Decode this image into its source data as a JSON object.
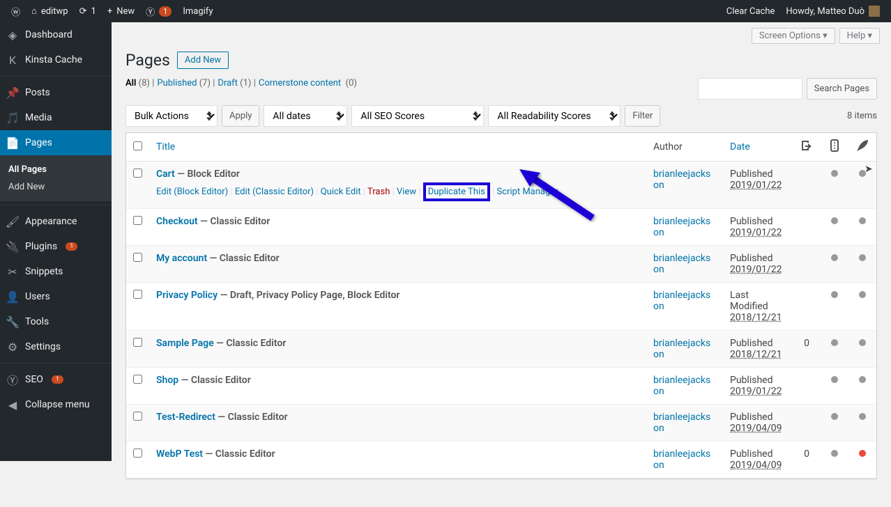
{
  "toolbar": {
    "site_name": "editwp",
    "updates_count": "1",
    "new_label": "New",
    "yoast_label": "",
    "yoast_count": "1",
    "imagify_label": "Imagify",
    "clear_cache": "Clear Cache",
    "howdy": "Howdy, Matteo Duò"
  },
  "sidebar": {
    "items": [
      {
        "icon": "dashboard",
        "label": "Dashboard"
      },
      {
        "icon": "kinsta",
        "label": "Kinsta Cache"
      },
      {
        "icon": "pin",
        "label": "Posts"
      },
      {
        "icon": "media",
        "label": "Media"
      },
      {
        "icon": "page",
        "label": "Pages",
        "current": true
      },
      {
        "icon": "appearance",
        "label": "Appearance"
      },
      {
        "icon": "plugin",
        "label": "Plugins",
        "badge": "1"
      },
      {
        "icon": "snippets",
        "label": "Snippets"
      },
      {
        "icon": "users",
        "label": "Users"
      },
      {
        "icon": "tools",
        "label": "Tools"
      },
      {
        "icon": "settings",
        "label": "Settings"
      },
      {
        "icon": "seo",
        "label": "SEO",
        "badge": "1"
      },
      {
        "icon": "collapse",
        "label": "Collapse menu"
      }
    ],
    "submenu": [
      "All Pages",
      "Add New"
    ]
  },
  "screen": {
    "options": "Screen Options",
    "help": "Help"
  },
  "page": {
    "title": "Pages",
    "add_new": "Add New"
  },
  "filters": {
    "all": "All",
    "all_count": "(8)",
    "published": "Published",
    "published_count": "(7)",
    "draft": "Draft",
    "draft_count": "(1)",
    "cornerstone": "Cornerstone content",
    "cornerstone_count": "(0)"
  },
  "actions": {
    "bulk": "Bulk Actions",
    "apply": "Apply",
    "dates": "All dates",
    "seo": "All SEO Scores",
    "readability": "All Readability Scores",
    "filter": "Filter",
    "item_count": "8 items",
    "search": "Search Pages"
  },
  "table": {
    "headers": {
      "title": "Title",
      "author": "Author",
      "date": "Date",
      "comments": ""
    },
    "row_actions": {
      "edit_block": "Edit (Block Editor)",
      "edit_classic": "Edit (Classic Editor)",
      "quick_edit": "Quick Edit",
      "trash": "Trash",
      "view": "View",
      "duplicate": "Duplicate This",
      "script_mgr": "Script Manager"
    },
    "rows": [
      {
        "title": "Cart",
        "state": "Block Editor",
        "author": "brianleejackson",
        "date_label": "Published",
        "date": "2019/01/22",
        "show_actions": true
      },
      {
        "title": "Checkout",
        "state": "Classic Editor",
        "author": "brianleejackson",
        "date_label": "Published",
        "date": "2019/01/22"
      },
      {
        "title": "My account",
        "state": "Classic Editor",
        "author": "brianleejackson",
        "date_label": "Published",
        "date": "2019/01/22"
      },
      {
        "title": "Privacy Policy",
        "state": "Draft, Privacy Policy Page, Block Editor",
        "author": "brianleejackson",
        "date_label": "Last Modified",
        "date": "2018/12/21"
      },
      {
        "title": "Sample Page",
        "state": "Classic Editor",
        "author": "brianleejackson",
        "date_label": "Published",
        "date": "2018/12/21",
        "comments": "0"
      },
      {
        "title": "Shop",
        "state": "Classic Editor",
        "author": "brianleejackson",
        "date_label": "Published",
        "date": "2019/01/22"
      },
      {
        "title": "Test-Redirect",
        "state": "Classic Editor",
        "author": "brianleejackson",
        "date_label": "Published",
        "date": "2019/04/09"
      },
      {
        "title": "WebP Test",
        "state": "Classic Editor",
        "author": "brianleejackson",
        "date_label": "Published",
        "date": "2019/04/09",
        "comments": "0",
        "red_dot": true
      }
    ]
  }
}
